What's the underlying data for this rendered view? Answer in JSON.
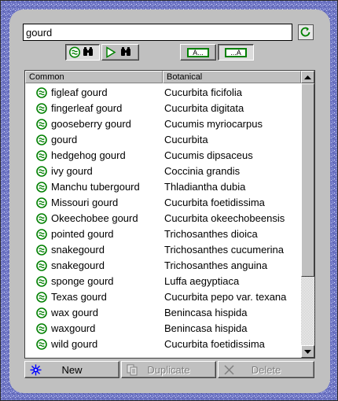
{
  "search": {
    "value": "gourd"
  },
  "columns": {
    "common": "Common",
    "botanical": "Botanical"
  },
  "rows": [
    {
      "common": "figleaf gourd",
      "botanical": "Cucurbita ficifolia"
    },
    {
      "common": "fingerleaf gourd",
      "botanical": "Cucurbita digitata"
    },
    {
      "common": "gooseberry gourd",
      "botanical": "Cucumis myriocarpus"
    },
    {
      "common": "gourd",
      "botanical": "Cucurbita"
    },
    {
      "common": "hedgehog gourd",
      "botanical": "Cucumis dipsaceus"
    },
    {
      "common": "ivy gourd",
      "botanical": "Coccinia grandis"
    },
    {
      "common": "Manchu tubergourd",
      "botanical": "Thladiantha dubia"
    },
    {
      "common": "Missouri gourd",
      "botanical": "Cucurbita foetidissima"
    },
    {
      "common": "Okeechobee gourd",
      "botanical": "Cucurbita okeechobeensis"
    },
    {
      "common": "pointed gourd",
      "botanical": "Trichosanthes dioica"
    },
    {
      "common": "snakegourd",
      "botanical": "Trichosanthes cucumerina"
    },
    {
      "common": "snakegourd",
      "botanical": "Trichosanthes anguina"
    },
    {
      "common": "sponge gourd",
      "botanical": "Luffa aegyptiaca"
    },
    {
      "common": "Texas gourd",
      "botanical": "Cucurbita pepo var. texana"
    },
    {
      "common": "wax gourd",
      "botanical": "Benincasa hispida"
    },
    {
      "common": "waxgourd",
      "botanical": "Benincasa hispida"
    },
    {
      "common": "wild gourd",
      "botanical": "Cucurbita foetidissima"
    }
  ],
  "row_icon": "plant-entry-icon",
  "toolbar": {
    "find_common": {
      "icon": "find-common-icon",
      "pressed": true
    },
    "find_botanical": {
      "icon": "find-botanical-icon",
      "pressed": false
    },
    "match_start": {
      "icon": "match-start-icon",
      "text": "A...",
      "pressed": false
    },
    "match_any": {
      "icon": "match-any-icon",
      "text": "...A",
      "pressed": true
    }
  },
  "buttons": {
    "new": {
      "label": "New",
      "icon": "new-icon",
      "enabled": true
    },
    "duplicate": {
      "label": "Duplicate",
      "icon": "duplicate-icon",
      "enabled": false
    },
    "delete": {
      "label": "Delete",
      "icon": "delete-icon",
      "enabled": false
    }
  },
  "scroll_position": 0,
  "colors": {
    "background": "#6f76c4",
    "panel": "#c0c0c0",
    "icon_green": "#008000"
  }
}
